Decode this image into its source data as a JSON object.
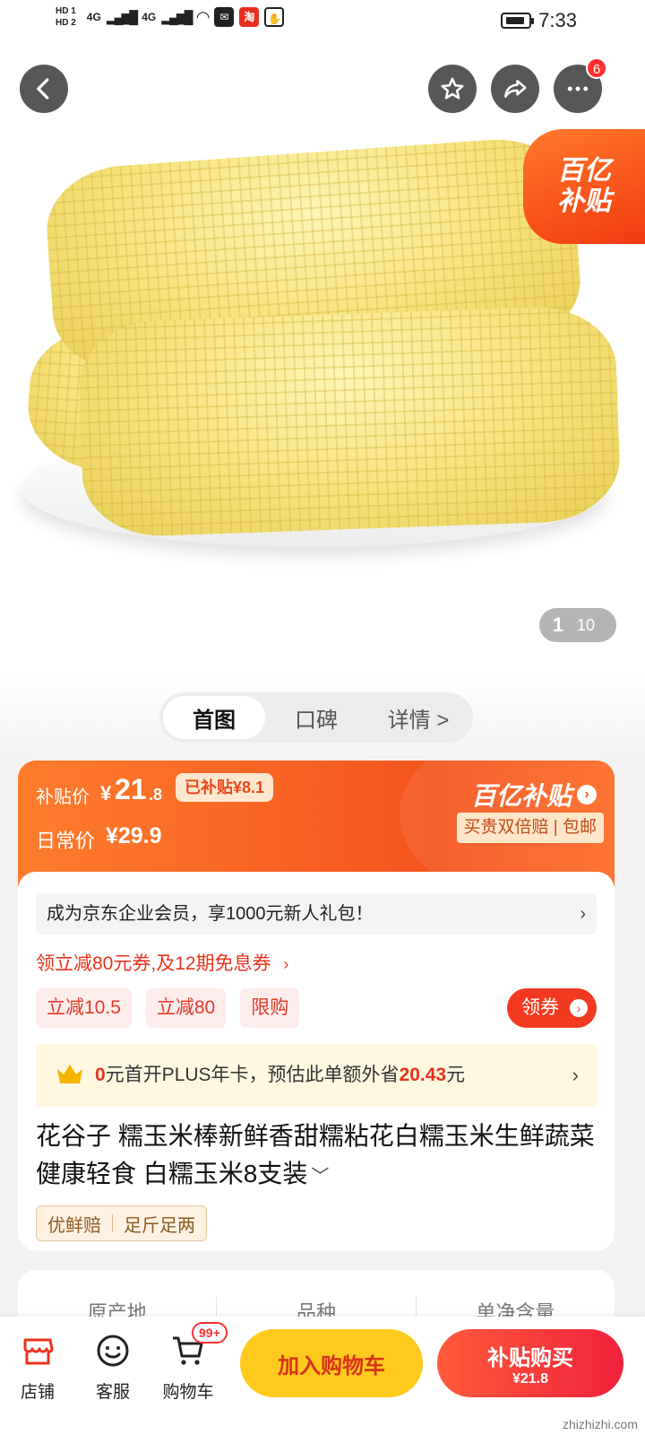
{
  "status_bar": {
    "hd1": "HD 1",
    "hd2": "HD 2",
    "net1": "4G",
    "net2": "4G",
    "time": "7:33"
  },
  "header": {
    "more_badge": "6"
  },
  "hero": {
    "subsidy_badge_line1": "百亿",
    "subsidy_badge_line2": "补贴",
    "page_current": "1",
    "page_total": "10"
  },
  "tabs": [
    {
      "label": "首图"
    },
    {
      "label": "口碑"
    },
    {
      "label": "详情 >"
    }
  ],
  "price": {
    "label": "补贴价",
    "symbol": "¥",
    "integer": "21",
    "decimal": ".8",
    "saved": "已补贴¥8.1",
    "daily_label": "日常价",
    "daily_price": "¥29.9",
    "program": "百亿补贴",
    "program_tags": "买贵双倍赔 | 包邮"
  },
  "promo": {
    "enterprise": "成为京东企业会员，享1000元新人礼包！",
    "coupon_link": "领立减80元券,及12期免息券",
    "chips": [
      "立减10.5",
      "立减80",
      "限购"
    ],
    "get_coupon": "领券",
    "plus_prefix": "0",
    "plus_mid": "元首开PLUS年卡，预估此单额外省",
    "plus_amount": "20.43",
    "plus_suffix": "元"
  },
  "product": {
    "title": "花谷子 糯玉米棒新鲜香甜糯粘花白糯玉米生鲜蔬菜 健康轻食 白糯玉米8支装",
    "guarantees": [
      "优鲜赔",
      "足斤足两"
    ]
  },
  "specs": [
    "原产地",
    "品种",
    "单净含量"
  ],
  "bottom_bar": {
    "shop": "店铺",
    "service": "客服",
    "cart": "购物车",
    "cart_badge": "99+",
    "add_cart": "加入购物车",
    "buy_main": "补贴购买",
    "buy_sub": "¥21.8",
    "watermark": "zhizhizhi.com"
  },
  "colors": {
    "accent": "#f4541e",
    "red": "#e8331c",
    "yellow_button": "#ffc91e"
  }
}
